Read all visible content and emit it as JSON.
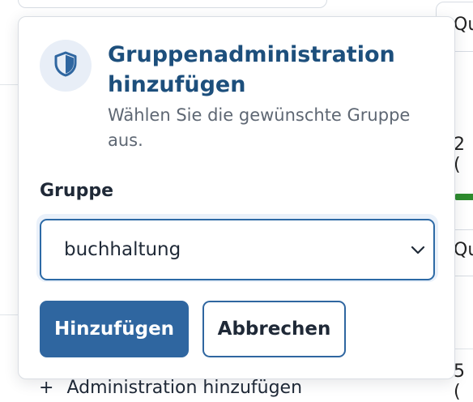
{
  "background": {
    "right_fragments": [
      "Qu",
      "2 (",
      "Qu",
      "5 ("
    ],
    "bottom_link": {
      "plus": "+",
      "label": "Administration hinzufügen"
    }
  },
  "dialog": {
    "icon": "shield-icon",
    "title": "Gruppenadministration hinzufügen",
    "subtitle": "Wählen Sie die gewünschte Gruppe aus.",
    "field_label": "Gruppe",
    "select": {
      "value": "buchhaltung",
      "icon": "chevron-down-icon"
    },
    "primary_button": "Hinzufügen",
    "secondary_button": "Abbrechen"
  },
  "colors": {
    "accent": "#2f66a0",
    "title": "#1d4f7c",
    "icon_badge_bg": "#e8eef7",
    "progress_green": "#2e8b2e"
  }
}
